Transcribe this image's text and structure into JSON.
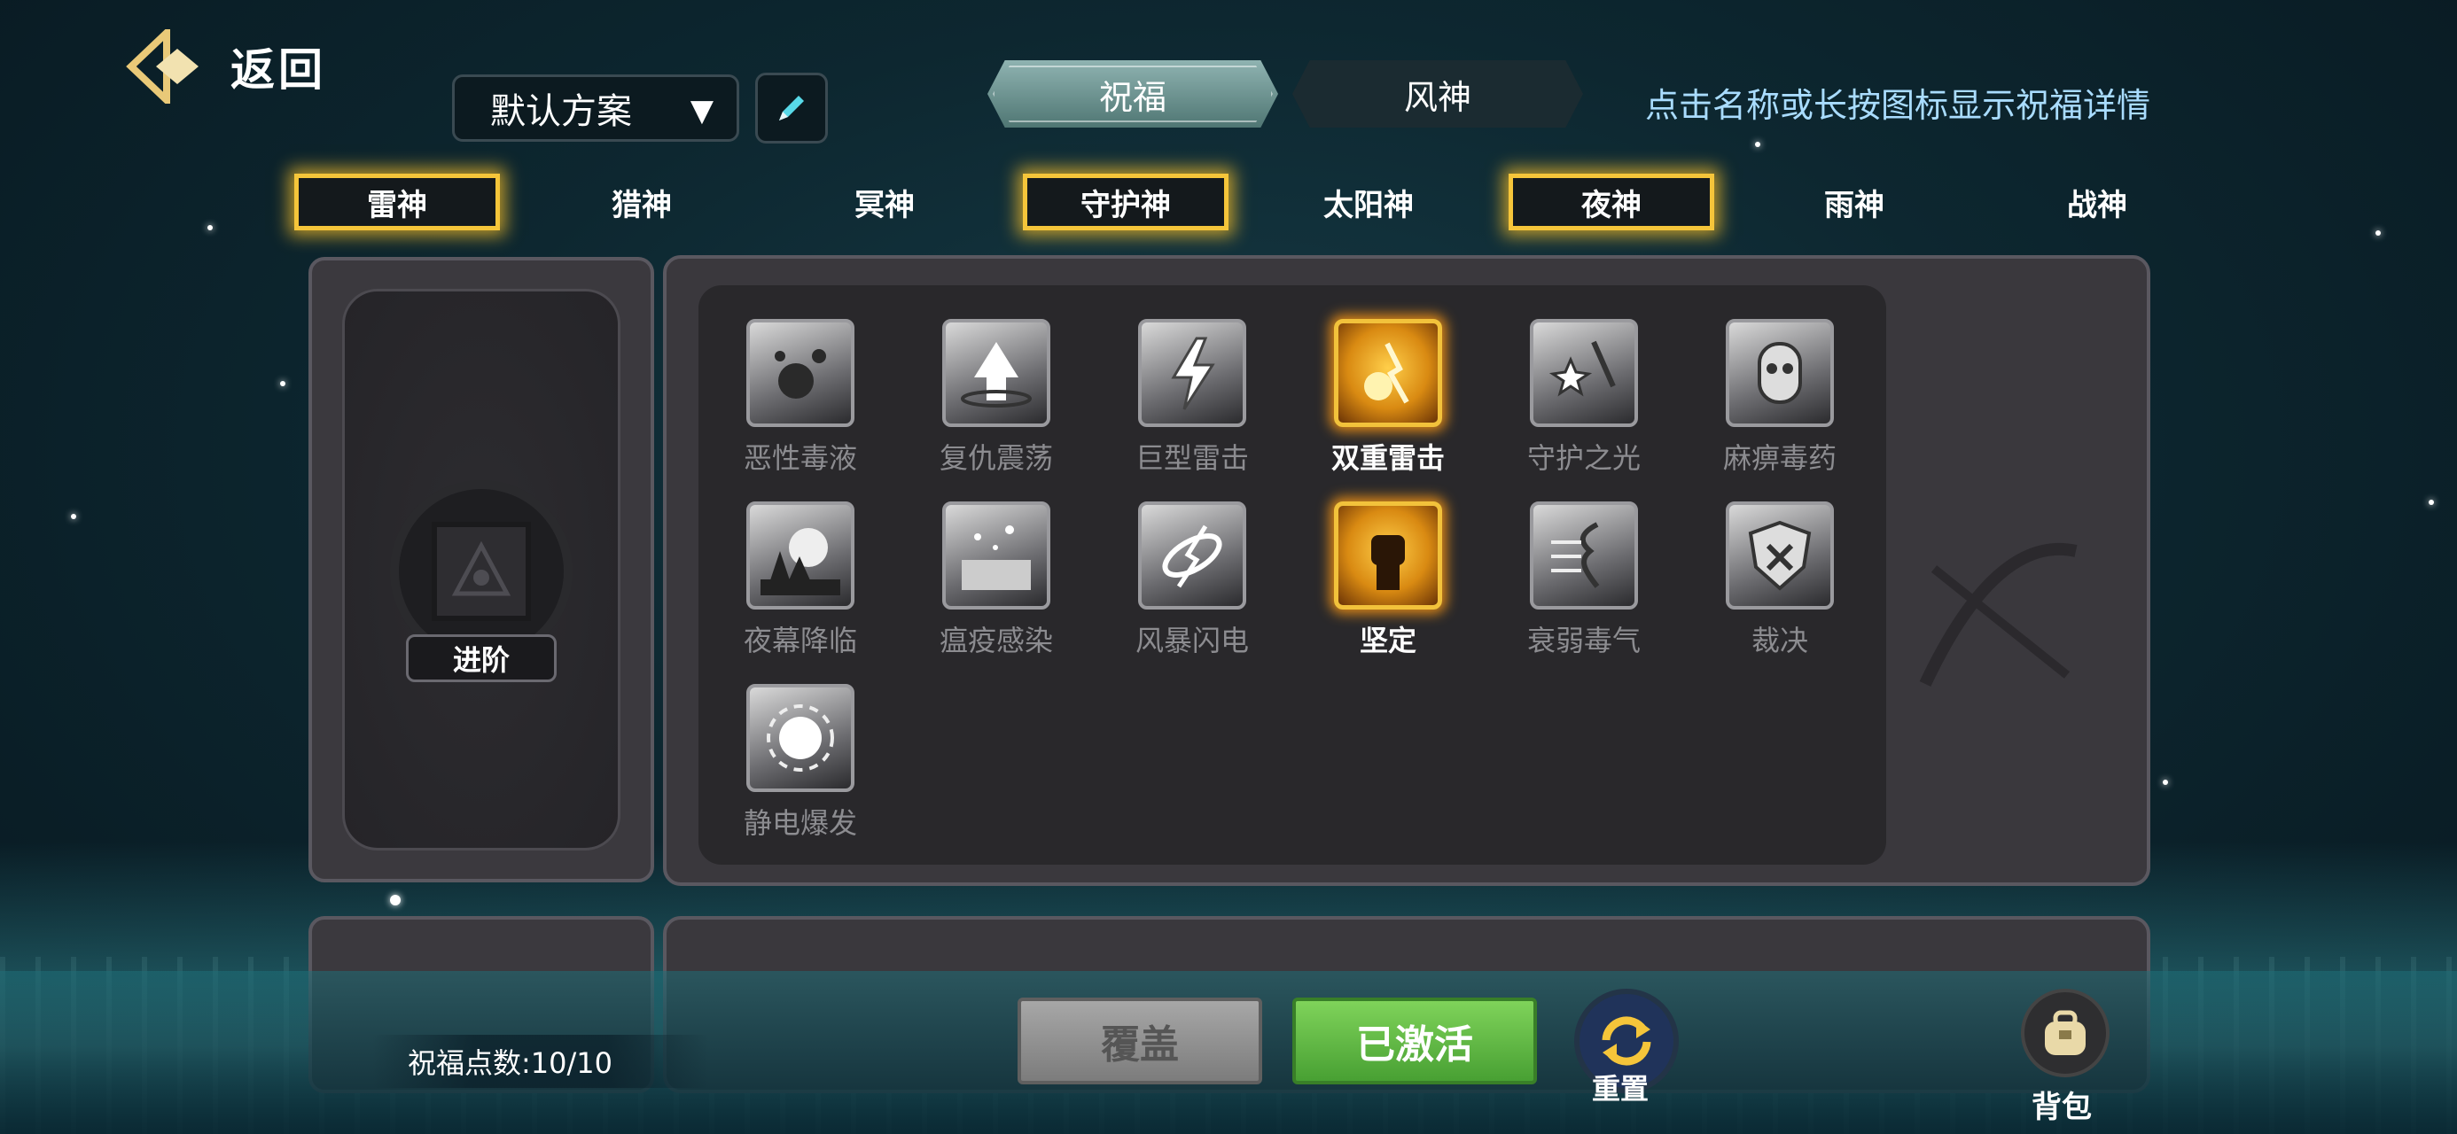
{
  "header": {
    "back_label": "返回"
  },
  "plan": {
    "selected": "默认方案"
  },
  "tabs": [
    {
      "label": "祝福",
      "active": true
    },
    {
      "label": "风神",
      "active": false
    }
  ],
  "hint": "点击名称或长按图标显示祝福详情",
  "gods": [
    {
      "label": "雷神",
      "selected": true
    },
    {
      "label": "猎神",
      "selected": false
    },
    {
      "label": "冥神",
      "selected": false
    },
    {
      "label": "守护神",
      "selected": true
    },
    {
      "label": "太阳神",
      "selected": false
    },
    {
      "label": "夜神",
      "selected": true
    },
    {
      "label": "雨神",
      "selected": false
    },
    {
      "label": "战神",
      "selected": false
    }
  ],
  "advance_label": "进阶",
  "skills": [
    {
      "label": "恶性毒液",
      "active": false,
      "icon": "venom-splash-icon"
    },
    {
      "label": "复仇震荡",
      "active": false,
      "icon": "shockwave-arrow-icon"
    },
    {
      "label": "巨型雷击",
      "active": false,
      "icon": "giant-lightning-icon"
    },
    {
      "label": "双重雷击",
      "active": true,
      "icon": "double-lightning-icon"
    },
    {
      "label": "守护之光",
      "active": false,
      "icon": "guardian-light-icon"
    },
    {
      "label": "麻痹毒药",
      "active": false,
      "icon": "paralysis-poison-icon"
    },
    {
      "label": "夜幕降临",
      "active": false,
      "icon": "nightfall-moon-icon"
    },
    {
      "label": "瘟疫感染",
      "active": false,
      "icon": "plague-icon"
    },
    {
      "label": "风暴闪电",
      "active": false,
      "icon": "storm-lightning-icon"
    },
    {
      "label": "坚定",
      "active": true,
      "icon": "fist-icon"
    },
    {
      "label": "衰弱毒气",
      "active": false,
      "icon": "weakness-gas-icon"
    },
    {
      "label": "裁决",
      "active": false,
      "icon": "judgment-shield-icon"
    },
    {
      "label": "静电爆发",
      "active": false,
      "icon": "static-burst-icon"
    }
  ],
  "footer": {
    "points_label": "祝福点数:10/10",
    "cover_label": "覆盖",
    "activated_label": "已激活",
    "reset_label": "重置",
    "bag_label": "背包"
  },
  "colors": {
    "gold": "#f5c53a",
    "green": "#5bb63f",
    "hint": "#a9dcff"
  }
}
